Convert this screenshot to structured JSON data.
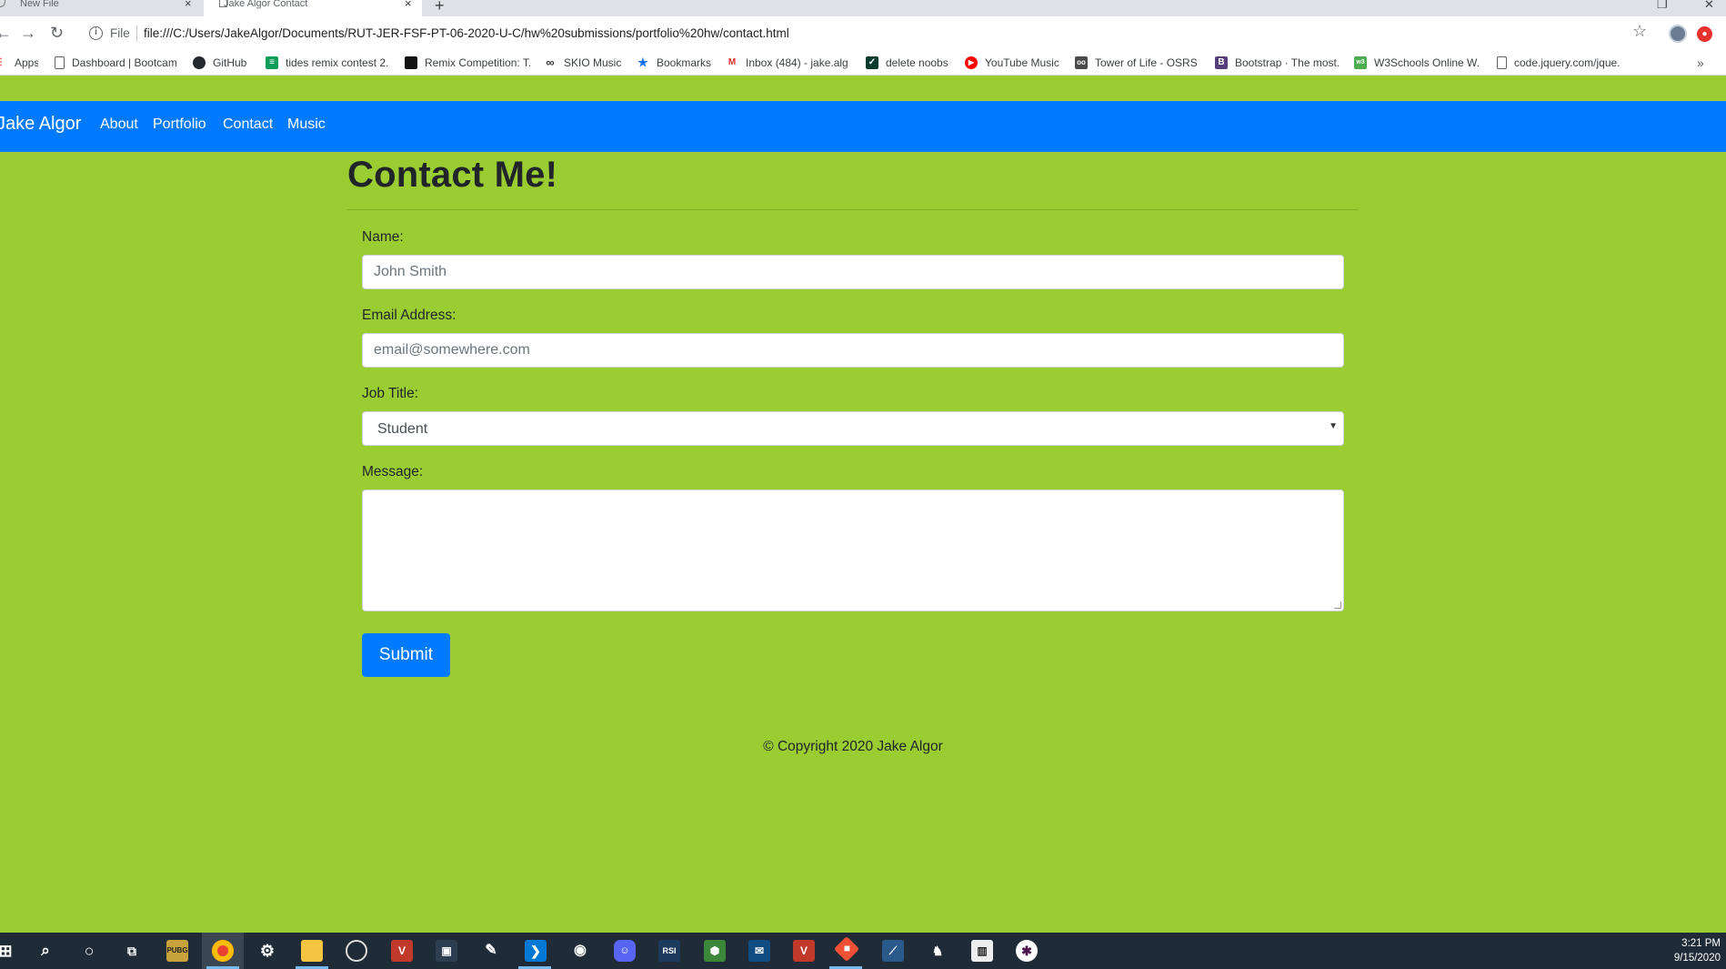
{
  "browser": {
    "tabs": [
      {
        "title": "New File",
        "active": false
      },
      {
        "title": "Jake Algor Contact",
        "active": true
      }
    ],
    "tab_close_glyph": "×",
    "new_tab_glyph": "+",
    "omnibox": {
      "scheme_label": "File",
      "url": "file:///C:/Users/JakeAlgor/Documents/RUT-JER-FSF-PT-06-2020-U-C/hw%20submissions/portfolio%20hw/contact.html"
    },
    "bookmarks": [
      {
        "label": "Apps",
        "icon": "apps-grid-icon",
        "color": "#e84335"
      },
      {
        "label": "Dashboard | Bootcamp",
        "icon": "page-icon",
        "color": "#ffffff"
      },
      {
        "label": "GitHub",
        "icon": "github-icon",
        "color": "#24292e"
      },
      {
        "label": "tides remix contest 2...",
        "icon": "sheets-icon",
        "color": "#0f9d58"
      },
      {
        "label": "Remix Competition: T...",
        "icon": "remix-icon",
        "color": "#111111"
      },
      {
        "label": "SKIO Music",
        "icon": "skio-icon",
        "color": "#333333"
      },
      {
        "label": "Bookmarks",
        "icon": "star-icon",
        "color": "#1a73e8"
      },
      {
        "label": "Inbox (484) - jake.alg...",
        "icon": "gmail-icon",
        "color": "#d93025"
      },
      {
        "label": "delete noobs",
        "icon": "check-icon",
        "color": "#0b3d2e"
      },
      {
        "label": "YouTube Music",
        "icon": "youtube-music-icon",
        "color": "#ff0000"
      },
      {
        "label": "Tower of Life - OSRS",
        "icon": "osrs-icon",
        "color": "#4a4a4a"
      },
      {
        "label": "Bootstrap · The most...",
        "icon": "bootstrap-icon",
        "color": "#563d7c"
      },
      {
        "label": "W3Schools Online W...",
        "icon": "w3schools-icon",
        "color": "#4caf50"
      },
      {
        "label": "code.jquery.com/jque...",
        "icon": "page-icon",
        "color": "#ffffff"
      }
    ],
    "more_glyph": "»"
  },
  "navbar": {
    "brand": "Jake Algor",
    "links": [
      "About",
      "Portfolio",
      "Contact",
      "Music"
    ],
    "bg_color": "#007bff"
  },
  "page": {
    "title": "Contact Me!",
    "bg_color": "#9acd32"
  },
  "form": {
    "name_label": "Name:",
    "name_placeholder": "John Smith",
    "email_label": "Email Address:",
    "email_placeholder": "email@somewhere.com",
    "job_label": "Job Title:",
    "job_selected": "Student",
    "message_label": "Message:",
    "message_value": "",
    "submit_label": "Submit"
  },
  "footer": {
    "copyright": "© Copyright 2020 Jake Algor"
  },
  "taskbar": {
    "items": [
      "windows-start-icon",
      "search-icon",
      "cortana-icon",
      "task-view-icon",
      "pubg-icon",
      "chrome-icon",
      "steelseries-icon",
      "file-explorer-icon",
      "discord-alt-icon",
      "vivaldi-icon",
      "game-icon",
      "blender-icon",
      "vscode-icon",
      "steam-icon",
      "discord-icon",
      "rsi-icon",
      "nodejs-icon",
      "mail-icon",
      "vivaldi-icon-2",
      "git-icon",
      "ssms-icon",
      "kiwi-icon",
      "piano-icon",
      "slack-icon"
    ],
    "time": "3:21 PM",
    "date": "9/15/2020"
  }
}
